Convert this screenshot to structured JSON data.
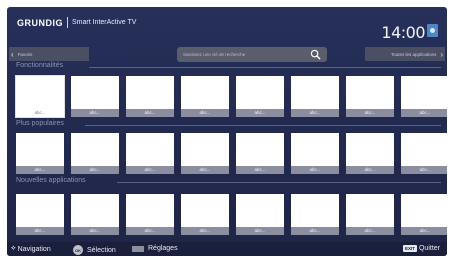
{
  "header": {
    "brand_logo": "GRUNDIG",
    "brand_name": "Smart InterActive TV",
    "clock": "14:00"
  },
  "topbar": {
    "favorites_label": "Favoris",
    "search_placeholder": "Saisissez une clé de recherche",
    "all_apps_label": "Toutes les applications"
  },
  "sections": [
    {
      "title": "Fonctionnalités",
      "tiles": [
        "abc...",
        "abc...",
        "abc...",
        "abc...",
        "abc...",
        "abc...",
        "abc...",
        "abc..."
      ]
    },
    {
      "title": "Plus populaires",
      "tiles": [
        "abc...",
        "abc...",
        "abc...",
        "abc...",
        "abc...",
        "abc...",
        "abc...",
        "abc..."
      ]
    },
    {
      "title": "Nouvelles applications",
      "tiles": [
        "abc...",
        "abc...",
        "abc...",
        "abc...",
        "abc...",
        "abc...",
        "abc...",
        "abc..."
      ]
    }
  ],
  "footer": {
    "navigation": "Navigation",
    "ok_key": "OK",
    "selection": "Sélection",
    "settings": "Réglages",
    "exit_key": "EXIT",
    "quit": "Quitter"
  },
  "colors": {
    "background": "#232a50",
    "tile": "#ffffff",
    "tile_label": "#8a8e9f",
    "section_title": "#8d93b0"
  }
}
